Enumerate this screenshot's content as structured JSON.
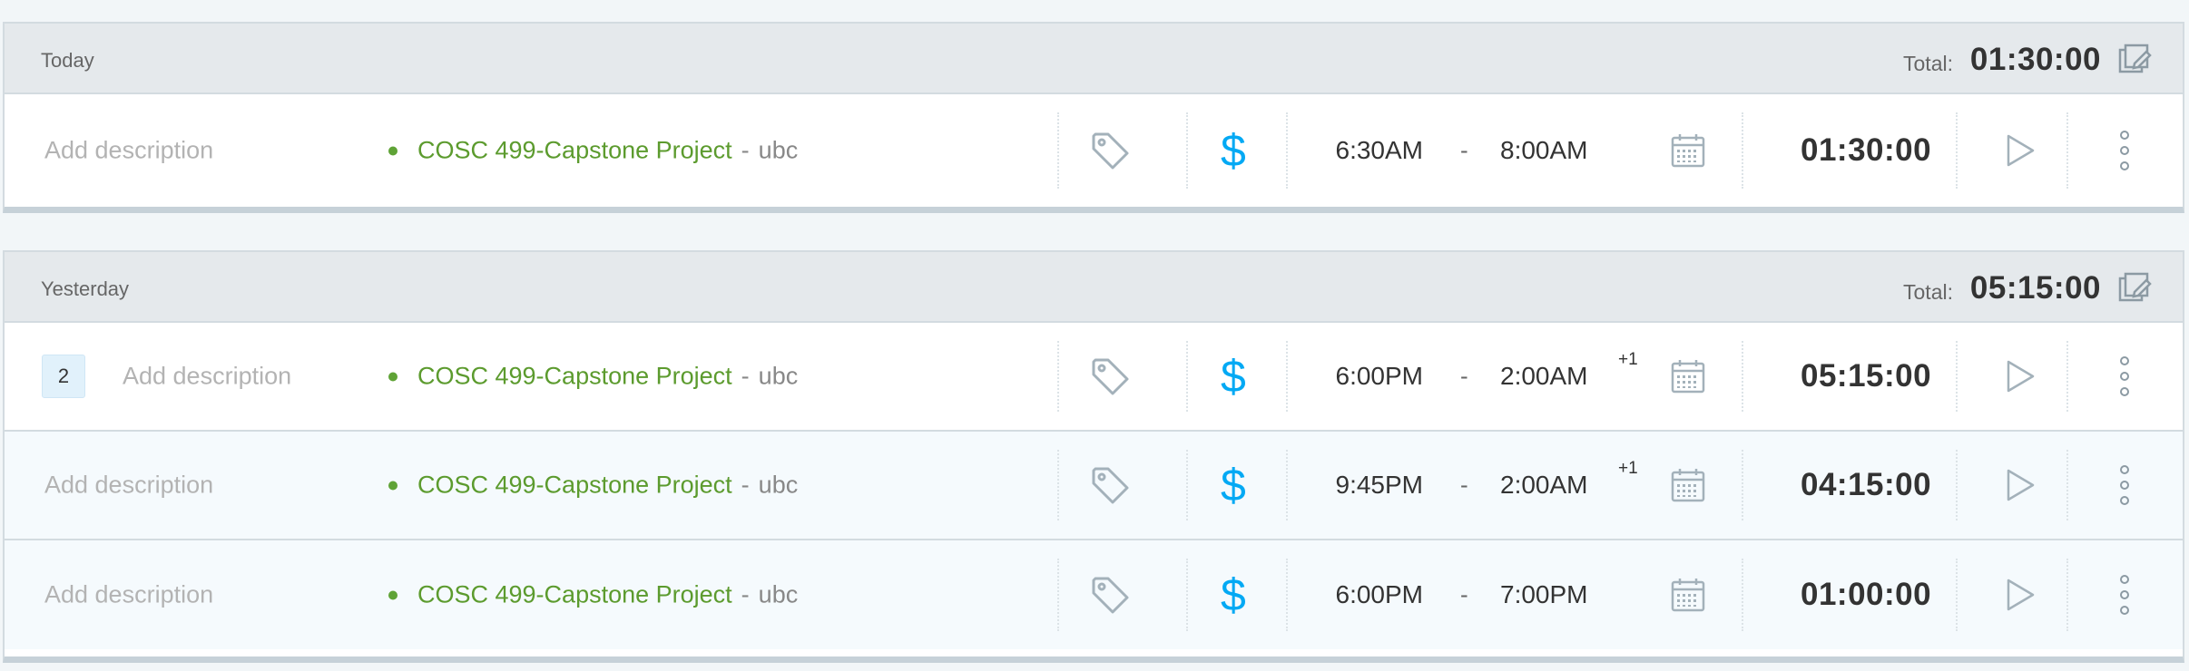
{
  "colors": {
    "accent": "#03a9f4",
    "project": "#5c9b2e",
    "project_dot": "#5fa336"
  },
  "groups": [
    {
      "date": "Today",
      "total_label": "Total:",
      "total_value": "01:30:00",
      "entries": [
        {
          "description_placeholder": "Add description",
          "project": "COSC 499-Capstone Project",
          "separator": "-",
          "client": "ubc",
          "start": "6:30AM",
          "dash": "-",
          "end": "8:00AM",
          "duration": "01:30:00"
        }
      ]
    },
    {
      "date": "Yesterday",
      "total_label": "Total:",
      "total_value": "05:15:00",
      "entries": [
        {
          "count": "2",
          "description_placeholder": "Add description",
          "project": "COSC 499-Capstone Project",
          "separator": "-",
          "client": "ubc",
          "start": "6:00PM",
          "dash": "-",
          "end": "2:00AM",
          "next_day": "+1",
          "duration": "05:15:00"
        },
        {
          "description_placeholder": "Add description",
          "project": "COSC 499-Capstone Project",
          "separator": "-",
          "client": "ubc",
          "start": "9:45PM",
          "dash": "-",
          "end": "2:00AM",
          "next_day": "+1",
          "duration": "04:15:00"
        },
        {
          "description_placeholder": "Add description",
          "project": "COSC 499-Capstone Project",
          "separator": "-",
          "client": "ubc",
          "start": "6:00PM",
          "dash": "-",
          "end": "7:00PM",
          "duration": "01:00:00"
        }
      ]
    }
  ],
  "icons": {
    "bulk_edit": "bulk-edit-icon",
    "tag": "tag-icon",
    "billable": "dollar-icon",
    "calendar": "calendar-icon",
    "play": "play-icon",
    "more": "more-vertical-icon"
  },
  "billable_symbol": "$"
}
